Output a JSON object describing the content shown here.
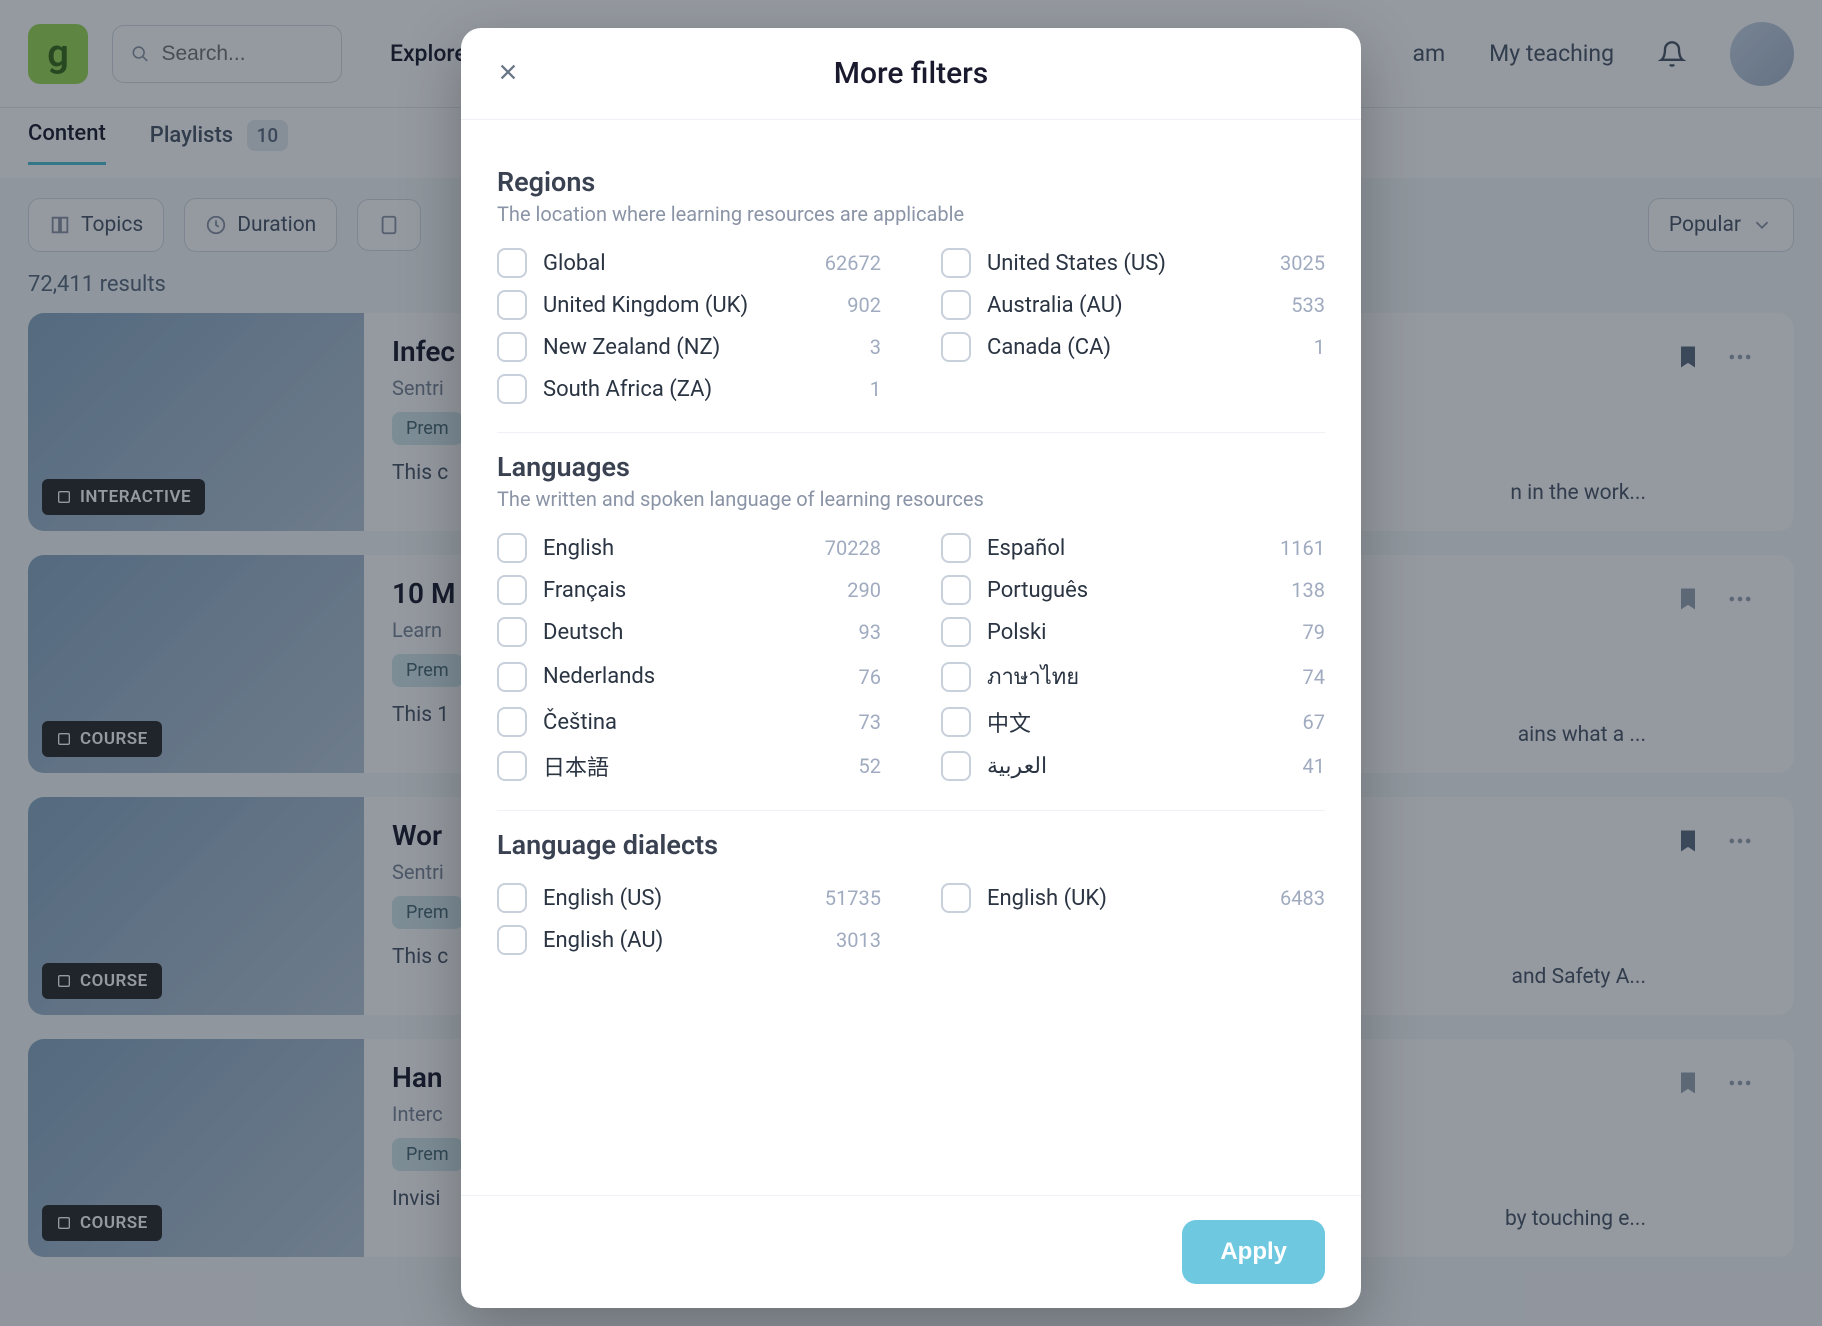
{
  "header": {
    "logo_char": "g",
    "search_placeholder": "Search...",
    "nav": [
      "Explore"
    ],
    "right_links": [
      "am",
      "My teaching"
    ]
  },
  "tabs": {
    "content": "Content",
    "playlists": "Playlists",
    "playlists_count": "10"
  },
  "chips": {
    "topics": "Topics",
    "duration": "Duration",
    "sort": "Popular"
  },
  "results_count": "72,411 results",
  "cards": [
    {
      "title": "Infec",
      "author": "Sentri",
      "badge": "Prem",
      "desc": "This c",
      "desc_tail": "n in the work...",
      "tag": "INTERACTIVE",
      "saved": true
    },
    {
      "title": "10 M",
      "author": "Learn",
      "badge": "Prem",
      "desc": "This 1",
      "desc_tail": "ains what a ...",
      "tag": "COURSE",
      "saved": false
    },
    {
      "title": "Wor",
      "author": "Sentri",
      "badge": "Prem",
      "desc": "This c",
      "desc_tail": "and Safety A...",
      "tag": "COURSE",
      "saved": true
    },
    {
      "title": "Han",
      "author": "Interc",
      "badge": "Prem",
      "desc": "Invisi",
      "desc_tail": "by touching e...",
      "tag": "COURSE",
      "saved": false
    }
  ],
  "modal": {
    "title": "More filters",
    "apply": "Apply",
    "sections": [
      {
        "title": "Regions",
        "sub": "The location where learning resources are applicable",
        "options": [
          {
            "label": "Global",
            "count": "62672"
          },
          {
            "label": "United States (US)",
            "count": "3025"
          },
          {
            "label": "United Kingdom (UK)",
            "count": "902"
          },
          {
            "label": "Australia (AU)",
            "count": "533"
          },
          {
            "label": "New Zealand (NZ)",
            "count": "3"
          },
          {
            "label": "Canada (CA)",
            "count": "1"
          },
          {
            "label": "South Africa (ZA)",
            "count": "1"
          }
        ]
      },
      {
        "title": "Languages",
        "sub": "The written and spoken language of learning resources",
        "options": [
          {
            "label": "English",
            "count": "70228"
          },
          {
            "label": "Español",
            "count": "1161"
          },
          {
            "label": "Français",
            "count": "290"
          },
          {
            "label": "Português",
            "count": "138"
          },
          {
            "label": "Deutsch",
            "count": "93"
          },
          {
            "label": "Polski",
            "count": "79"
          },
          {
            "label": "Nederlands",
            "count": "76"
          },
          {
            "label": "ภาษาไทย",
            "count": "74"
          },
          {
            "label": "Čeština",
            "count": "73"
          },
          {
            "label": "中文",
            "count": "67"
          },
          {
            "label": "日本語",
            "count": "52"
          },
          {
            "label": "العربية",
            "count": "41"
          }
        ]
      },
      {
        "title": "Language dialects",
        "sub": "",
        "options": [
          {
            "label": "English (US)",
            "count": "51735"
          },
          {
            "label": "English (UK)",
            "count": "6483"
          },
          {
            "label": "English (AU)",
            "count": "3013"
          }
        ]
      }
    ]
  }
}
